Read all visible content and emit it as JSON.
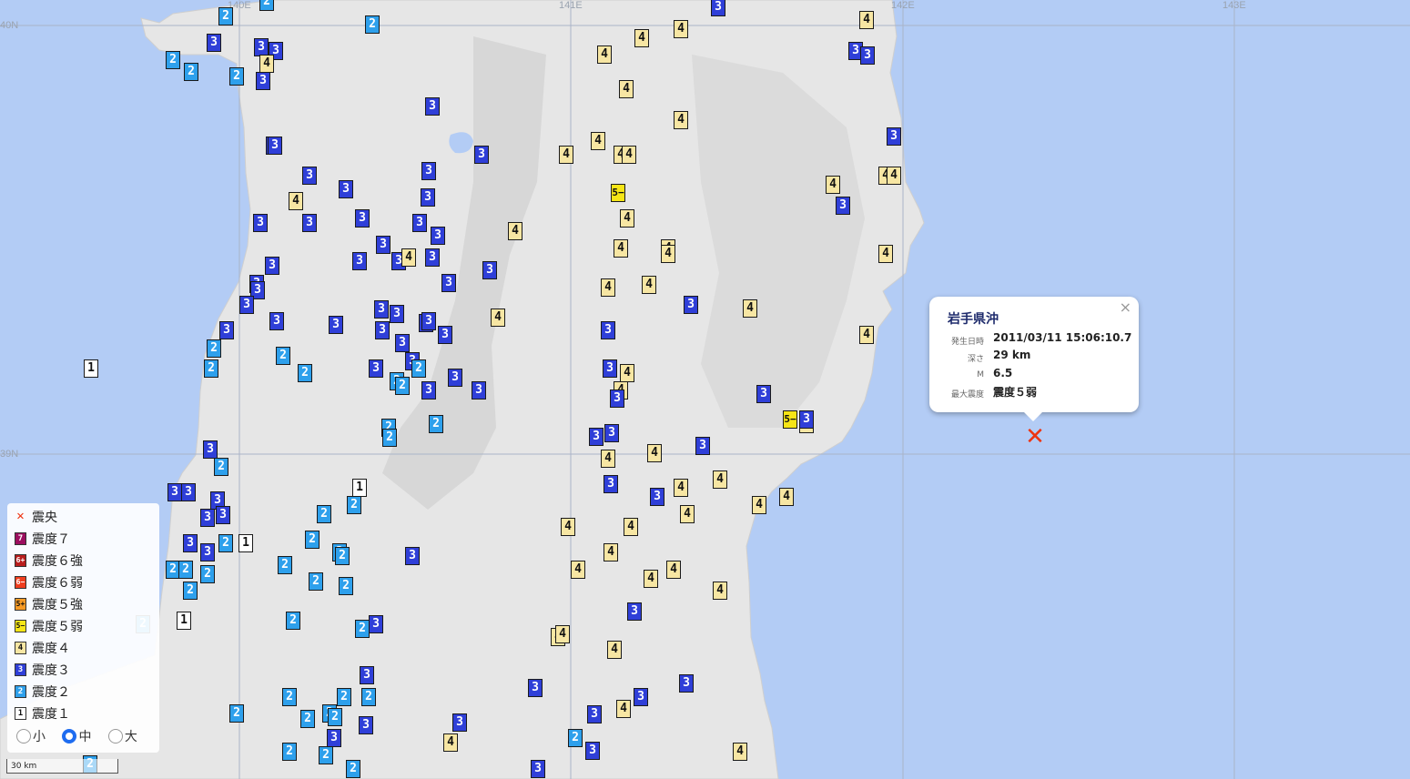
{
  "grid": {
    "lat_labels": [
      "40N",
      "39N"
    ],
    "lon_labels": [
      "140E",
      "141E",
      "142E",
      "143E"
    ]
  },
  "colors": {
    "sea": "#b3ccf5",
    "land": "#e6e6e6",
    "intensity_1": "#ffffff",
    "intensity_2": "#2ea0ec",
    "intensity_3": "#2f3fd8",
    "intensity_4": "#f7e6a3",
    "intensity_5_weak": "#f6e516",
    "intensity_5_strong": "#f79a25",
    "intensity_6_weak": "#ef3d1e",
    "intensity_6_strong": "#b81d1d",
    "intensity_7": "#9c0f5f",
    "epicenter": "#ee3311"
  },
  "popup": {
    "close": "×",
    "title": "岩手県沖",
    "rows": [
      {
        "key": "発生日時",
        "value": "2011/03/11 15:06:10.7"
      },
      {
        "key": "深さ",
        "value": "29 km"
      },
      {
        "key": "M",
        "value": "6.5"
      },
      {
        "key": "最大震度",
        "value": "震度５弱"
      }
    ]
  },
  "epicenter": {
    "symbol": "✕",
    "icon": "epicenter-x-icon"
  },
  "legend": {
    "items": [
      {
        "swatch": "✕",
        "label": "震央"
      },
      {
        "swatch": "7",
        "label": "震度７"
      },
      {
        "swatch": "6+",
        "label": "震度６強"
      },
      {
        "swatch": "6−",
        "label": "震度６弱"
      },
      {
        "swatch": "5+",
        "label": "震度５強"
      },
      {
        "swatch": "5−",
        "label": "震度５弱"
      },
      {
        "swatch": "4",
        "label": "震度４"
      },
      {
        "swatch": "3",
        "label": "震度３"
      },
      {
        "swatch": "2",
        "label": "震度２"
      },
      {
        "swatch": "1",
        "label": "震度１"
      }
    ],
    "size_options": [
      "小",
      "中",
      "大"
    ],
    "size_selected": "中"
  },
  "scale_bar": "30 km",
  "stations": [
    [
      "2",
      248,
      18
    ],
    [
      "2",
      293,
      2
    ],
    [
      "2",
      409,
      27
    ],
    [
      "3",
      235,
      47
    ],
    [
      "3",
      287,
      52
    ],
    [
      "3",
      303,
      56
    ],
    [
      "2",
      190,
      66
    ],
    [
      "2",
      210,
      79
    ],
    [
      "2",
      260,
      84
    ],
    [
      "4",
      293,
      70
    ],
    [
      "3",
      289,
      89
    ],
    [
      "3",
      940,
      56
    ],
    [
      "3",
      953,
      61
    ],
    [
      "4",
      952,
      22
    ],
    [
      "3",
      789,
      8
    ],
    [
      "4",
      748,
      32
    ],
    [
      "4",
      705,
      42
    ],
    [
      "4",
      664,
      60
    ],
    [
      "4",
      688,
      98
    ],
    [
      "4",
      748,
      132
    ],
    [
      "3",
      475,
      117
    ],
    [
      "3",
      300,
      160
    ],
    [
      "3",
      302,
      160
    ],
    [
      "3",
      529,
      170
    ],
    [
      "3",
      471,
      188
    ],
    [
      "4",
      657,
      155
    ],
    [
      "4",
      622,
      170
    ],
    [
      "4",
      682,
      170
    ],
    [
      "4",
      691,
      170
    ],
    [
      "3",
      982,
      150
    ],
    [
      "4",
      973,
      193
    ],
    [
      "4",
      982,
      193
    ],
    [
      "4",
      915,
      203
    ],
    [
      "3",
      926,
      226
    ],
    [
      "3",
      340,
      193
    ],
    [
      "3",
      380,
      208
    ],
    [
      "3",
      470,
      217
    ],
    [
      "4",
      325,
      221
    ],
    [
      "3",
      286,
      245
    ],
    [
      "3",
      340,
      245
    ],
    [
      "3",
      398,
      240
    ],
    [
      "3",
      461,
      245
    ],
    [
      "3",
      481,
      259
    ],
    [
      "5−",
      679,
      212
    ],
    [
      "4",
      689,
      240
    ],
    [
      "4",
      566,
      254
    ],
    [
      "4",
      682,
      273
    ],
    [
      "4",
      734,
      273
    ],
    [
      "4",
      734,
      279
    ],
    [
      "4",
      973,
      279
    ],
    [
      "3",
      421,
      269
    ],
    [
      "3",
      395,
      287
    ],
    [
      "3",
      438,
      287
    ],
    [
      "4",
      449,
      283
    ],
    [
      "3",
      475,
      283
    ],
    [
      "3",
      538,
      297
    ],
    [
      "3",
      299,
      292
    ],
    [
      "3",
      282,
      312
    ],
    [
      "3",
      283,
      319
    ],
    [
      "3",
      271,
      335
    ],
    [
      "4",
      668,
      316
    ],
    [
      "4",
      713,
      313
    ],
    [
      "3",
      493,
      311
    ],
    [
      "3",
      419,
      340
    ],
    [
      "3",
      436,
      345
    ],
    [
      "3",
      304,
      353
    ],
    [
      "3",
      369,
      357
    ],
    [
      "3",
      468,
      355
    ],
    [
      "3",
      471,
      353
    ],
    [
      "3",
      489,
      368
    ],
    [
      "3",
      420,
      363
    ],
    [
      "3",
      759,
      335
    ],
    [
      "4",
      824,
      339
    ],
    [
      "4",
      547,
      349
    ],
    [
      "3",
      668,
      363
    ],
    [
      "4",
      952,
      368
    ],
    [
      "3",
      249,
      363
    ],
    [
      "2",
      235,
      383
    ],
    [
      "3",
      442,
      377
    ],
    [
      "3",
      453,
      397
    ],
    [
      "2",
      311,
      391
    ],
    [
      "2",
      232,
      405
    ],
    [
      "1",
      100,
      405
    ],
    [
      "2",
      335,
      410
    ],
    [
      "3",
      413,
      405
    ],
    [
      "2",
      460,
      405
    ],
    [
      "3",
      500,
      415
    ],
    [
      "3",
      670,
      405
    ],
    [
      "4",
      689,
      410
    ],
    [
      "2",
      436,
      419
    ],
    [
      "2",
      442,
      424
    ],
    [
      "3",
      471,
      429
    ],
    [
      "3",
      526,
      429
    ],
    [
      "4",
      682,
      429
    ],
    [
      "3",
      678,
      438
    ],
    [
      "3",
      839,
      433
    ],
    [
      "2",
      427,
      470
    ],
    [
      "2",
      428,
      481
    ],
    [
      "2",
      479,
      466
    ],
    [
      "5−",
      868,
      461
    ],
    [
      "4",
      886,
      466
    ],
    [
      "3",
      886,
      461
    ],
    [
      "3",
      672,
      476
    ],
    [
      "3",
      655,
      480
    ],
    [
      "3",
      772,
      490
    ],
    [
      "3",
      231,
      494
    ],
    [
      "2",
      243,
      513
    ],
    [
      "4",
      719,
      498
    ],
    [
      "4",
      668,
      504
    ],
    [
      "3",
      671,
      532
    ],
    [
      "4",
      791,
      527
    ],
    [
      "4",
      748,
      536
    ],
    [
      "3",
      722,
      546
    ],
    [
      "1",
      395,
      536
    ],
    [
      "2",
      389,
      555
    ],
    [
      "3",
      192,
      541
    ],
    [
      "3",
      207,
      541
    ],
    [
      "3",
      239,
      550
    ],
    [
      "3",
      245,
      566
    ],
    [
      "3",
      228,
      569
    ],
    [
      "2",
      356,
      565
    ],
    [
      "4",
      864,
      546
    ],
    [
      "4",
      834,
      555
    ],
    [
      "4",
      755,
      565
    ],
    [
      "4",
      624,
      579
    ],
    [
      "4",
      693,
      579
    ],
    [
      "3",
      209,
      597
    ],
    [
      "3",
      228,
      607
    ],
    [
      "2",
      248,
      597
    ],
    [
      "1",
      270,
      597
    ],
    [
      "2",
      343,
      593
    ],
    [
      "2",
      373,
      607
    ],
    [
      "2",
      376,
      611
    ],
    [
      "3",
      453,
      611
    ],
    [
      "4",
      671,
      607
    ],
    [
      "4",
      635,
      626
    ],
    [
      "4",
      740,
      626
    ],
    [
      "4",
      715,
      636
    ],
    [
      "2",
      190,
      626
    ],
    [
      "2",
      204,
      626
    ],
    [
      "2",
      228,
      631
    ],
    [
      "2",
      313,
      621
    ],
    [
      "2",
      347,
      639
    ],
    [
      "2",
      380,
      644
    ],
    [
      "2",
      209,
      649
    ],
    [
      "4",
      791,
      649
    ],
    [
      "3",
      697,
      672
    ],
    [
      "2",
      322,
      682
    ],
    [
      "1",
      202,
      682
    ],
    [
      "2",
      398,
      691
    ],
    [
      "3",
      413,
      686
    ],
    [
      "2",
      157,
      686
    ],
    [
      "4",
      613,
      700
    ],
    [
      "4",
      618,
      697
    ],
    [
      "4",
      675,
      714
    ],
    [
      "3",
      403,
      742
    ],
    [
      "3",
      754,
      751
    ],
    [
      "3",
      588,
      756
    ],
    [
      "3",
      704,
      766
    ],
    [
      "2",
      318,
      766
    ],
    [
      "2",
      378,
      766
    ],
    [
      "2",
      405,
      766
    ],
    [
      "4",
      685,
      779
    ],
    [
      "2",
      260,
      784
    ],
    [
      "2",
      338,
      790
    ],
    [
      "2",
      362,
      784
    ],
    [
      "2",
      368,
      788
    ],
    [
      "3",
      653,
      785
    ],
    [
      "3",
      505,
      794
    ],
    [
      "3",
      402,
      797
    ],
    [
      "4",
      495,
      816
    ],
    [
      "2",
      632,
      811
    ],
    [
      "3",
      651,
      825
    ],
    [
      "2",
      318,
      826
    ],
    [
      "2",
      358,
      830
    ],
    [
      "3",
      367,
      811
    ],
    [
      "4",
      813,
      826
    ],
    [
      "2",
      388,
      845
    ],
    [
      "3",
      591,
      845
    ],
    [
      "2",
      99,
      840
    ]
  ]
}
